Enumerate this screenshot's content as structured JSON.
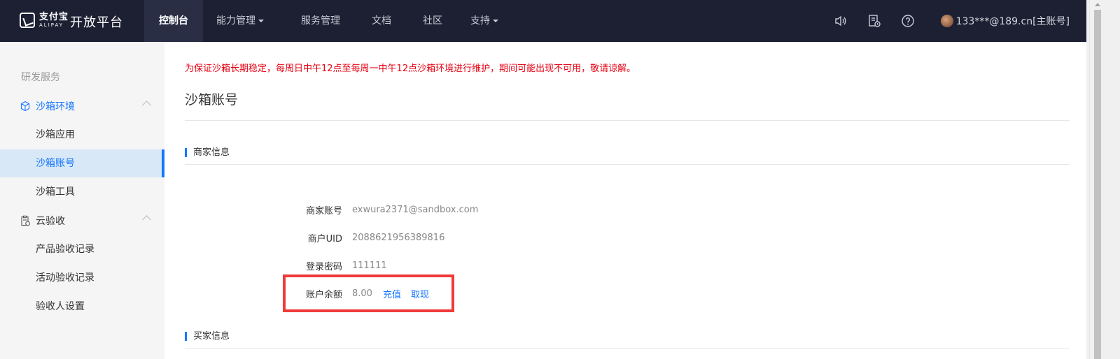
{
  "header": {
    "logo": {
      "cn": "支付宝",
      "en": "ALIPAY"
    },
    "platform": "开放平台",
    "nav": [
      {
        "label": "控制台",
        "active": true,
        "dropdown": false
      },
      {
        "label": "能力管理",
        "active": false,
        "dropdown": true
      },
      {
        "label": "服务管理",
        "active": false,
        "dropdown": false
      },
      {
        "label": "文档",
        "active": false,
        "dropdown": false
      },
      {
        "label": "社区",
        "active": false,
        "dropdown": false
      },
      {
        "label": "支持",
        "active": false,
        "dropdown": true
      }
    ],
    "icons": [
      "speaker-icon",
      "document-clock-icon",
      "help-icon"
    ],
    "user": "133***@189.cn[主账号]"
  },
  "sidebar": {
    "section": "研发服务",
    "groups": [
      {
        "label": "沙箱环境",
        "icon": "cube-icon",
        "expanded": true,
        "items": [
          {
            "label": "沙箱应用",
            "active": false
          },
          {
            "label": "沙箱账号",
            "active": true
          },
          {
            "label": "沙箱工具",
            "active": false
          }
        ]
      },
      {
        "label": "云验收",
        "icon": "clipboard-icon",
        "expanded": true,
        "items": [
          {
            "label": "产品验收记录",
            "active": false
          },
          {
            "label": "活动验收记录",
            "active": false
          },
          {
            "label": "验收人设置",
            "active": false
          }
        ]
      }
    ]
  },
  "main": {
    "notice": "为保证沙箱长期稳定，每周日中午12点至每周一中午12点沙箱环境进行维护，期间可能出现不可用，敬请谅解。",
    "title": "沙箱账号",
    "merchant_section": "商家信息",
    "merchant": {
      "account_label": "商家账号",
      "account_value": "exwura2371@sandbox.com",
      "uid_label": "商户UID",
      "uid_value": "2088621956389816",
      "password_label": "登录密码",
      "password_value": "111111",
      "balance_label": "账户余额",
      "balance_value": "8.00",
      "recharge": "充值",
      "withdraw": "取现"
    },
    "buyer_section": "买家信息"
  },
  "colors": {
    "topbar": "#1d2033",
    "accent": "#1677ff",
    "notice": "#e60012",
    "highlight_box": "#f03a3a"
  }
}
